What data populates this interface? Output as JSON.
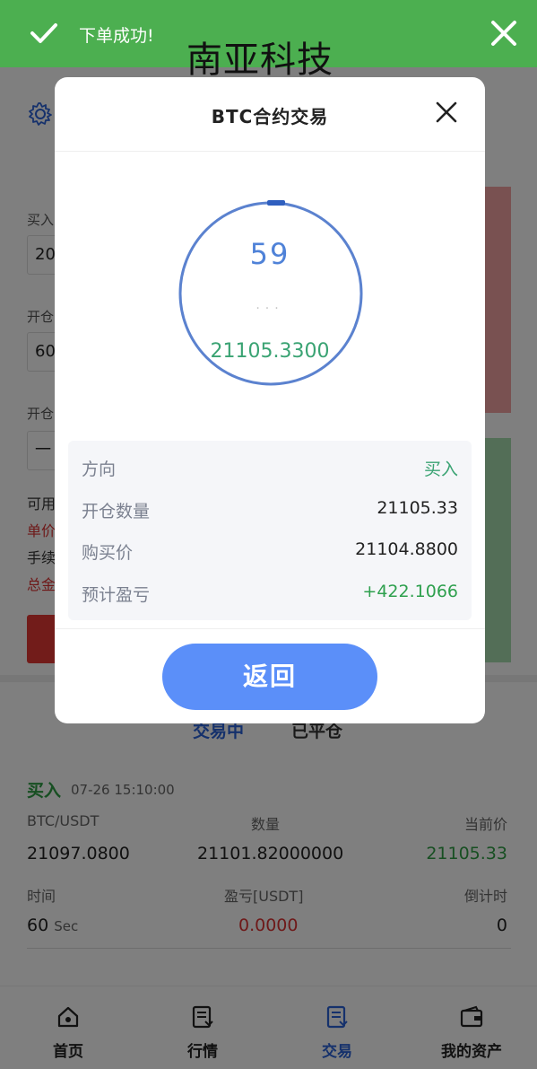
{
  "brand": "南亚科技",
  "toast": {
    "message": "下单成功!"
  },
  "modal": {
    "title": "BTC合约交易",
    "countdown": "59",
    "ring_price": "21105.3300",
    "details": [
      {
        "label": "方向",
        "value": "买入"
      },
      {
        "label": "开仓数量",
        "value": "21105.33"
      },
      {
        "label": "购买价",
        "value": "21104.8800"
      },
      {
        "label": "预计盈亏",
        "value": "+422.1066"
      }
    ],
    "return_label": "返回"
  },
  "form": {
    "buy_label": "买入",
    "amount_value": "20",
    "open_label": "开仓",
    "open_value": "60",
    "open_label2": "开仓",
    "stepper_value": "一",
    "available_label": "可用",
    "unit_price_label": "单价",
    "fee_label": "手续",
    "total_label": "总金"
  },
  "tabs": {
    "active": "交易中",
    "inactive": "已平仓"
  },
  "trade": {
    "side": "买入",
    "time": "07-26 15:10:00",
    "headers1": [
      "BTC/USDT",
      "数量",
      "当前价"
    ],
    "values1": [
      "21097.0800",
      "21101.82000000",
      "21105.33"
    ],
    "headers2": [
      "时间",
      "盈亏[USDT]",
      "倒计时"
    ],
    "time_value": "60",
    "time_unit": "Sec",
    "pnl_value": "0.0000",
    "countdown_value": "0"
  },
  "nav": [
    {
      "label": "首页",
      "icon": "home-icon"
    },
    {
      "label": "行情",
      "icon": "market-icon"
    },
    {
      "label": "交易",
      "icon": "trade-icon"
    },
    {
      "label": "我的资产",
      "icon": "wallet-icon"
    }
  ],
  "colors": {
    "toast_green": "#4caf50",
    "primary_blue": "#5b8ff9",
    "tab_blue": "#2b62d8",
    "profit_green": "#2ea04e",
    "loss_red": "#d33333"
  }
}
